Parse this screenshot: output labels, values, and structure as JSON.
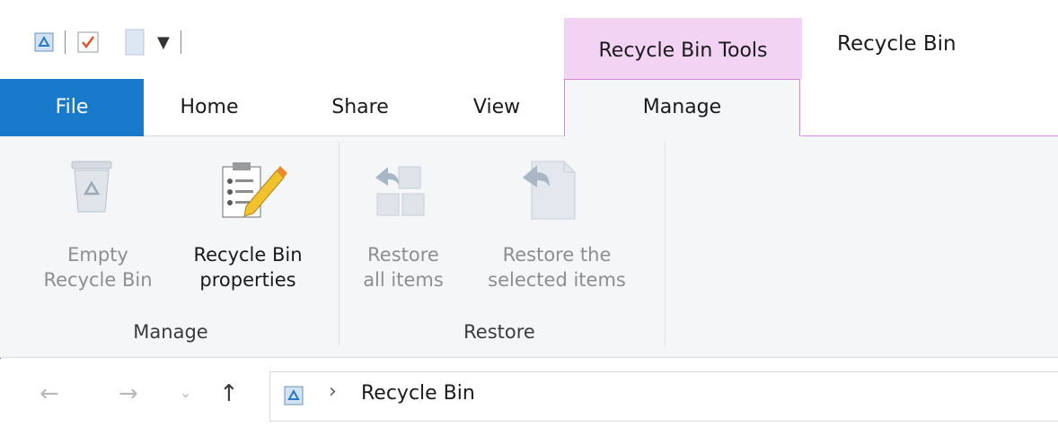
{
  "window": {
    "title": "Recycle Bin",
    "contextual_tab_group": "Recycle Bin Tools"
  },
  "tabs": [
    {
      "label": "File",
      "active": false
    },
    {
      "label": "Home",
      "active": false
    },
    {
      "label": "Share",
      "active": false
    },
    {
      "label": "View",
      "active": false
    },
    {
      "label": "Manage",
      "active": true
    }
  ],
  "ribbon": {
    "groups": [
      {
        "label": "Manage",
        "buttons": [
          {
            "line1": "Empty",
            "line2": "Recycle Bin",
            "enabled": false,
            "icon": "recycle-bin-icon"
          },
          {
            "line1": "Recycle Bin",
            "line2": "properties",
            "enabled": true,
            "icon": "properties-icon"
          }
        ]
      },
      {
        "label": "Restore",
        "buttons": [
          {
            "line1": "Restore",
            "line2": "all items",
            "enabled": false,
            "icon": "restore-all-icon"
          },
          {
            "line1": "Restore the",
            "line2": "selected items",
            "enabled": false,
            "icon": "restore-selected-icon"
          }
        ]
      }
    ]
  },
  "address_bar": {
    "breadcrumb": "Recycle Bin"
  },
  "colors": {
    "file_tab": "#1979ca",
    "context_tab": "#f2d3f4",
    "context_border": "#d48ad8",
    "ribbon_bg": "#f5f6f7"
  }
}
